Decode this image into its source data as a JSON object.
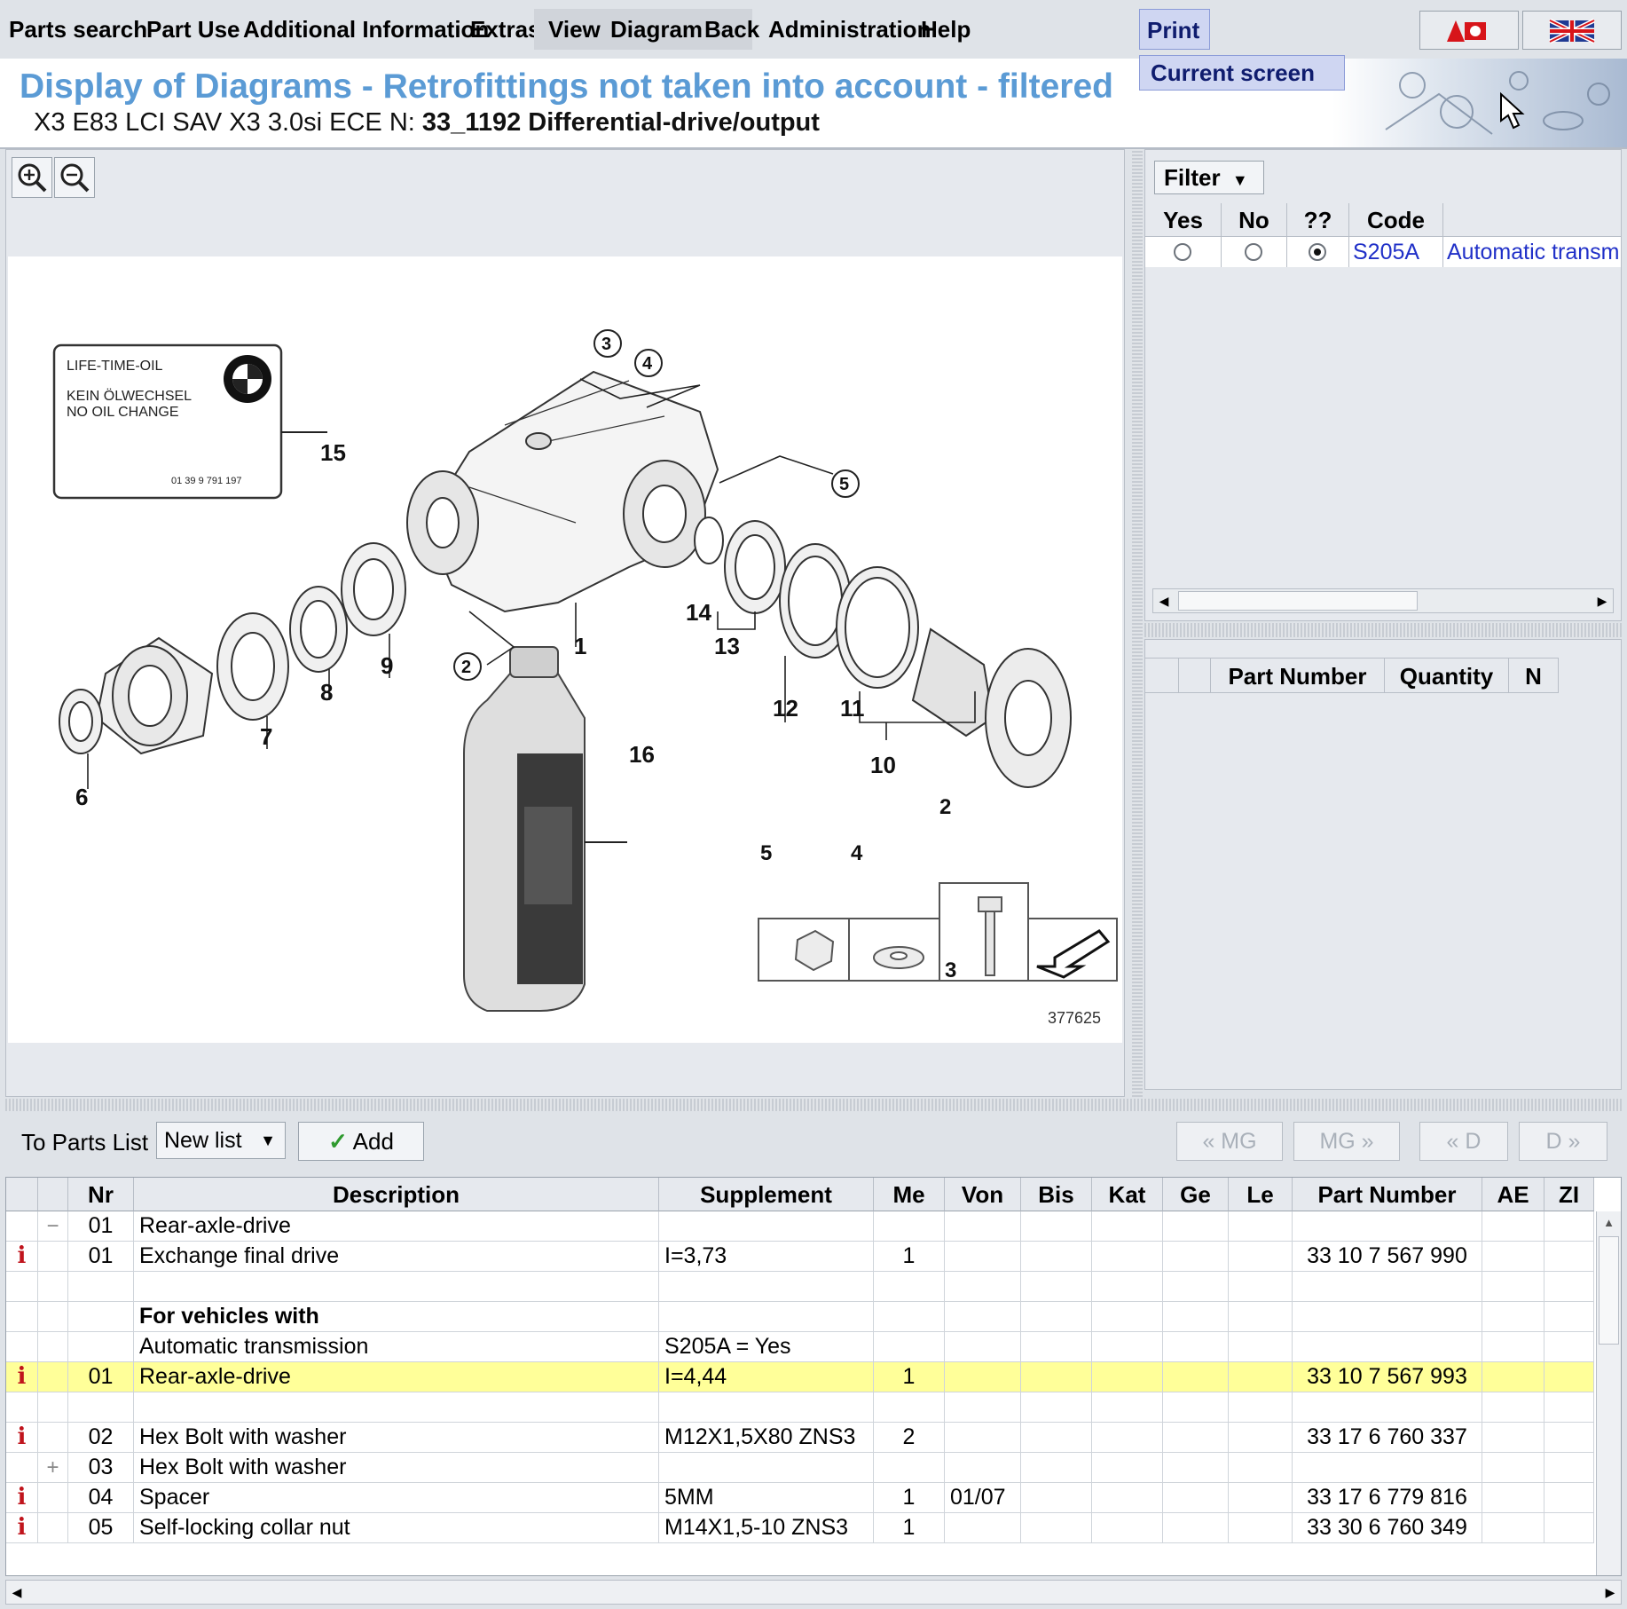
{
  "menu": {
    "items": [
      "Parts search",
      "Part Use",
      "Additional Information",
      "Extras",
      "View",
      "Diagram",
      "Back",
      "Administration",
      "Help",
      "Print"
    ],
    "dropdown_item": "Current screen"
  },
  "header": {
    "title": "Display of Diagrams - Retrofittings not taken into account - filtered",
    "vehicle": "X3 E83 LCI SAV X3 3.0si ECE",
    "node_label": "N:",
    "node_value": "33_1192 Differential-drive/output"
  },
  "diagram": {
    "image_number": "377625",
    "sticker": {
      "line1": "LIFE-TIME-OIL",
      "line2": "KEIN ÖLWECHSEL",
      "line3": "NO OIL CHANGE",
      "code": "01 39 9 791 197"
    },
    "callouts": [
      "1",
      "2",
      "3",
      "4",
      "5",
      "6",
      "7",
      "8",
      "9",
      "10",
      "11",
      "12",
      "13",
      "14",
      "15",
      "16"
    ],
    "inset_callouts": [
      "2",
      "3",
      "4",
      "5"
    ]
  },
  "filter": {
    "button_label": "Filter",
    "columns": [
      "Yes",
      "No",
      "??",
      "Code"
    ],
    "rows": [
      {
        "code": "S205A",
        "description": "Automatic transm",
        "selected": "??"
      }
    ]
  },
  "parts_panel": {
    "columns": [
      "",
      "",
      "Part Number",
      "Quantity",
      "N"
    ]
  },
  "toolbar": {
    "to_parts_list_label": "To Parts List",
    "list_select_value": "New list",
    "add_label": "Add",
    "nav_buttons": [
      "« MG",
      "MG »",
      "« D",
      "D »"
    ]
  },
  "table": {
    "columns": [
      "",
      "",
      "Nr",
      "Description",
      "Supplement",
      "Me",
      "Von",
      "Bis",
      "Kat",
      "Ge",
      "Le",
      "Part Number",
      "AE",
      "ZI"
    ],
    "rows": [
      {
        "info": "",
        "tree": "−",
        "nr": "01",
        "description": "Rear-axle-drive",
        "supplement": "",
        "me": "",
        "von": "",
        "bis": "",
        "part_number": "",
        "bold": false,
        "highlight": false
      },
      {
        "info": "i",
        "tree": "",
        "nr": "01",
        "description": "Exchange final drive",
        "supplement": "I=3,73",
        "me": "1",
        "von": "",
        "bis": "",
        "part_number": "33 10 7 567 990",
        "bold": false,
        "highlight": false
      },
      {
        "info": "",
        "tree": "",
        "nr": "",
        "description": "",
        "supplement": "",
        "me": "",
        "von": "",
        "bis": "",
        "part_number": "",
        "bold": false,
        "highlight": false
      },
      {
        "info": "",
        "tree": "",
        "nr": "",
        "description": "For vehicles with",
        "supplement": "",
        "me": "",
        "von": "",
        "bis": "",
        "part_number": "",
        "bold": true,
        "highlight": false
      },
      {
        "info": "",
        "tree": "",
        "nr": "",
        "description": "Automatic transmission",
        "supplement": "S205A = Yes",
        "me": "",
        "von": "",
        "bis": "",
        "part_number": "",
        "bold": false,
        "highlight": false
      },
      {
        "info": "i",
        "tree": "",
        "nr": "01",
        "description": "Rear-axle-drive",
        "supplement": "I=4,44",
        "me": "1",
        "von": "",
        "bis": "",
        "part_number": "33 10 7 567 993",
        "bold": false,
        "highlight": true
      },
      {
        "info": "",
        "tree": "",
        "nr": "",
        "description": "",
        "supplement": "",
        "me": "",
        "von": "",
        "bis": "",
        "part_number": "",
        "bold": false,
        "highlight": false
      },
      {
        "info": "i",
        "tree": "",
        "nr": "02",
        "description": "Hex Bolt with washer",
        "supplement": "M12X1,5X80 ZNS3",
        "me": "2",
        "von": "",
        "bis": "",
        "part_number": "33 17 6 760 337",
        "bold": false,
        "highlight": false
      },
      {
        "info": "",
        "tree": "+",
        "nr": "03",
        "description": "Hex Bolt with washer",
        "supplement": "",
        "me": "",
        "von": "",
        "bis": "",
        "part_number": "",
        "bold": false,
        "highlight": false
      },
      {
        "info": "i",
        "tree": "",
        "nr": "04",
        "description": "Spacer",
        "supplement": "5MM",
        "me": "1",
        "von": "01/07",
        "bis": "",
        "part_number": "33 17 6 779 816",
        "bold": false,
        "highlight": false
      },
      {
        "info": "i",
        "tree": "",
        "nr": "05",
        "description": "Self-locking collar nut",
        "supplement": "M14X1,5-10 ZNS3",
        "me": "1",
        "von": "",
        "bis": "",
        "part_number": "33 30 6 760 349",
        "bold": false,
        "highlight": false
      }
    ]
  },
  "colors": {
    "title_blue": "#5b9bd5",
    "highlight_yellow": "#ffff99",
    "info_red": "#c0141c",
    "link_blue": "#2030c8"
  }
}
